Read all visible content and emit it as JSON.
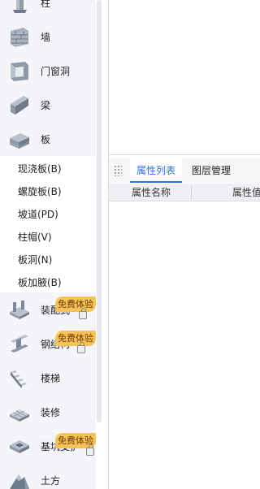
{
  "tree": {
    "categories": [
      {
        "label": "柱",
        "icon": "column-icon"
      },
      {
        "label": "墙",
        "icon": "wall-icon"
      },
      {
        "label": "门窗洞",
        "icon": "door-window-icon"
      },
      {
        "label": "梁",
        "icon": "beam-icon"
      },
      {
        "label": "板",
        "icon": "slab-icon"
      }
    ],
    "slab_children": [
      {
        "label": "现浇板(B)"
      },
      {
        "label": "螺旋板(B)"
      },
      {
        "label": "坡道(PD)"
      },
      {
        "label": "柱帽(V)"
      },
      {
        "label": "板洞(N)"
      },
      {
        "label": "板加腋(B)"
      }
    ],
    "lower_categories": [
      {
        "label": "装配式",
        "icon": "prefab-icon",
        "badge": "免费体验"
      },
      {
        "label": "钢结构",
        "icon": "steel-structure-icon",
        "badge": "免费体验"
      },
      {
        "label": "楼梯",
        "icon": "stairs-icon",
        "badge": ""
      },
      {
        "label": "装修",
        "icon": "decoration-icon",
        "badge": ""
      },
      {
        "label": "基坑支护",
        "icon": "foundation-pit-icon",
        "badge": "免费体验"
      },
      {
        "label": "土方",
        "icon": "earthwork-icon",
        "badge": ""
      }
    ]
  },
  "panel": {
    "tabs": [
      {
        "label": "属性列表",
        "active": true
      },
      {
        "label": "图层管理",
        "active": false
      }
    ],
    "columns": [
      "属性名称",
      "属性值"
    ]
  },
  "colors": {
    "accent": "#2f6fd6",
    "badge": "#f6c25a",
    "tree_bg": "#f3f5f8"
  }
}
